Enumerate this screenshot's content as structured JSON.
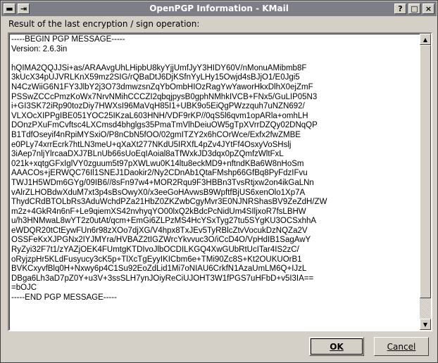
{
  "window": {
    "title": "OpenPGP Information - KMail",
    "left_buttons": [
      "▬",
      "⇥"
    ],
    "right_buttons": [
      "?",
      "□",
      "×"
    ]
  },
  "label": "Result of the last encryption / sign operation:",
  "message": "-----BEGIN PGP MESSAGE-----\nVersion: 2.6.3in\n\nhQIMA2QQJJSi+as/ARAAvgUhLHipbU8kyYjjUmfJyY3HIDY60V/nMonuAMibmb8F\n3kUcX34pUJVRLKnX59mz2SIG/rQBaDtJ6DjKSfnYyLHy15Owjd4sBJjO1/E0Jgi5\nN4CzWiiG6N1FY3JlbY2j3O73dmwzsnZqYbOmbHIOzRagYwYaworHkxDlhX0ejZmF\nPSSwZCCcPmzKoWx7NrvNMihCCCZI2qbqjpysB0gphNMhkIVCB+FNx5/GuLIP05N3\ni+GI3SK72iRp90tozDiy7HWXsI96MaVqH85I1+UBK9o5EiQgPWzzquh7uNZN692/\nVLXOcXIPPgIBE051YOC25IKzaL603HNH/VDF9rKP//0qS5l6qvm1opARla+omhLH\nDOnzPXuFmCvftsc4LXCmsd4bhglgs35PmaTmVlhDeiuOW5gTpXVrrDZQy02DNqQP\nB1TdfOseyif4nRpiMYSxiO/P8nCbN5fOO/02gmITZY2x6hCOrWce/Exfx2fwZMBE\ne0PLy74xrrEcrk7htLN3meU+qXaXt277NKdU5IRXfL4pZv4JYtFf4OsxyVoSHslj\n3iAep7nljYlrcaaDXJ7BLnUb66sUoEqIAoial8aTfWxkJD3dqx0pZQmfzWltFxL\n021k+xqtgGFxIglVY0zguum5t97pXWLwu0K14ltu8eckMD9+nftndKBa6W8nHoSm\nAAACOs+jERWQC76Il1SNEJ1Daokir2/Ny2CDnAb1QtaFMshp66GfBq8PyFdzIFvu\nTWJ1H5WDm6GYg/09IB6//8sFn97w4+MOR2Rqu9F3HBBn3TvsRtjxw2on4ikGaLNn\nvAlrZLHOBdwXduM7xt3p4sBsOwyX0/x3eeGoHAvwsB9WpftfBjUS6xenOlo1Xp7A\nThydCRdBTOLbRs3AduWchdPZa21HbZ0ZKZwbCgyMvr3E0NJNRShasBV9ZeZdH/ZW\nm2z+4GkR4n6nF+Le9qiemXS42nvhyqYO00lxQ2kBdcPcNidUm4SIljxoR7fsLBHW\nu/h3HNMwaL8wYT2z0utAt/qcm+EmGi6ZLPzMS4HcYSxTyg27tu5SYgKU3OCSxhhA\neWDQR20tCtEywFUn6r98zXOo7djXG/V4hpx8TxJEv5TyRBlcZtvVocukDzNQZa2V\nOSSFeKxXJPGNx2IYJMYra/HVBAZ2tIGZWrcYkvvuc3O/iCcD4O/VpHdIB1SagAwY\nRyZyi32F7t1/zYAZjOEK4FUmtgKTDIvoJlbOCDILKGQ4XwGUbRtUcITar4IS2zC/\noRyjzpHr5KLdFusyucy3cK5p+TlXcTgEyyIKICbm6e+TMi90Zc8S+Kt2OUKUOrB1\nBVKCxyvfBlq0H+Nxwy6p4C1Su92EoZdLid1Mi7oNIAU6CrkfN1AzaUmLM6Q+IJzL\nDBga6Lh3aD7pZ0Y+u3V+3ssSLH7ynJOiyReCiUJOHT3W1fPGS7uHFbD+v5I3IA==\n=bOJC\n-----END PGP MESSAGE-----",
  "buttons": {
    "ok": "OK",
    "cancel": "Cancel"
  }
}
